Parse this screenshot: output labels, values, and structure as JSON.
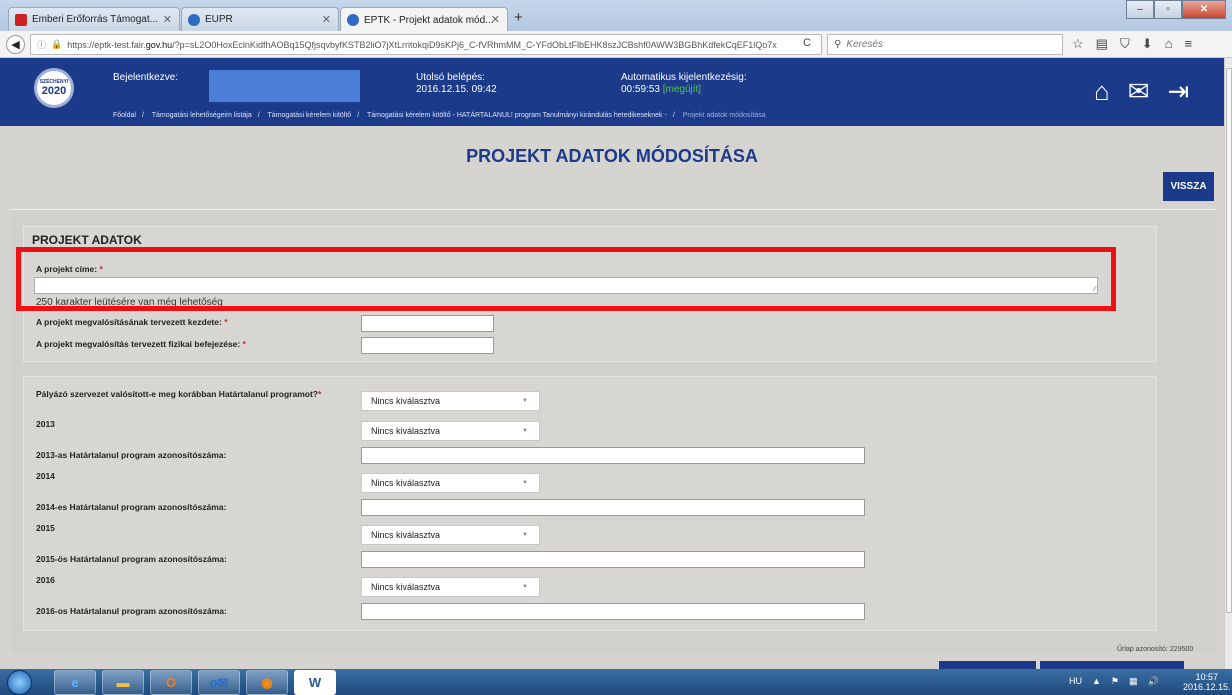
{
  "browser": {
    "tabs": [
      {
        "label": "Emberi Erőforrás Támogat...",
        "color": "#cc2222"
      },
      {
        "label": "EUPR",
        "color": "#2f6bc2"
      },
      {
        "label": "EPTK - Projekt adatok mód...",
        "color": "#2f6bc2"
      }
    ],
    "url_prefix": "https://eptk-test.fair.",
    "url_domain": "gov.hu",
    "url_rest": "/?p=sL2O0HoxEclnKidfhAOBq15QfjsqvbyfKSTB2liO7jXtLrritokqiD9sKPj6_C-fVRhmMM_C-YFdObLtFlbEHK8szJCBshf0AWW3BGBhKdfekCqEF1lQo7x",
    "search_placeholder": "Keresés"
  },
  "header": {
    "logo_top": "SZÉCHENYI",
    "logo_year": "2020",
    "logged_in_label": "Bejelentkezve:",
    "last_login_label": "Utolsó belépés:",
    "last_login_value": "2016.12.15. 09:42",
    "auto_logout_label": "Automatikus kijelentkezésig:",
    "auto_logout_value": "00:59:53",
    "auto_logout_renew": "[megújít]",
    "breadcrumb": [
      "Főoldal",
      "Támogatási lehetőségeim listája",
      "Támogatási kérelem kitöltő",
      "Támogatási kérelem kitöltő - HATÁRTALANUL! program Tanulmányi kirándulás hetedikeseknek -",
      "Projekt adatok módosítása"
    ]
  },
  "page": {
    "title": "PROJEKT ADATOK MÓDOSÍTÁSA",
    "back_button": "VISSZA",
    "section_title": "PROJEKT ADATOK",
    "project_title_label": "A projekt címe:",
    "char_count_text": "250 karakter leütésére van még lehetőség",
    "start_label": "A projekt megvalósításának tervezett kezdete:",
    "end_label": "A projekt megvalósítás tervezett fizikai befejezése:",
    "prev_program_label": "Pályázó szervezet valósított-e meg korábban Határtalanul programot?",
    "select_placeholder": "Nincs kiválasztva",
    "year_2013": "2013",
    "id_2013_label": "2013-as Határtalanul program azonosítószáma:",
    "year_2014": "2014",
    "id_2014_label": "2014-es Határtalanul program azonosítószáma:",
    "year_2015": "2015",
    "id_2015_label": "2015-ös Határtalanul program azonosítószáma:",
    "year_2016": "2016",
    "id_2016_label": "2016-os Határtalanul program azonosítószáma:",
    "required_mark": "*",
    "form_id": "Űrlap azonosító: 229500"
  },
  "taskbar": {
    "lang": "HU",
    "time": "10:57",
    "date": "2016.12.15."
  }
}
